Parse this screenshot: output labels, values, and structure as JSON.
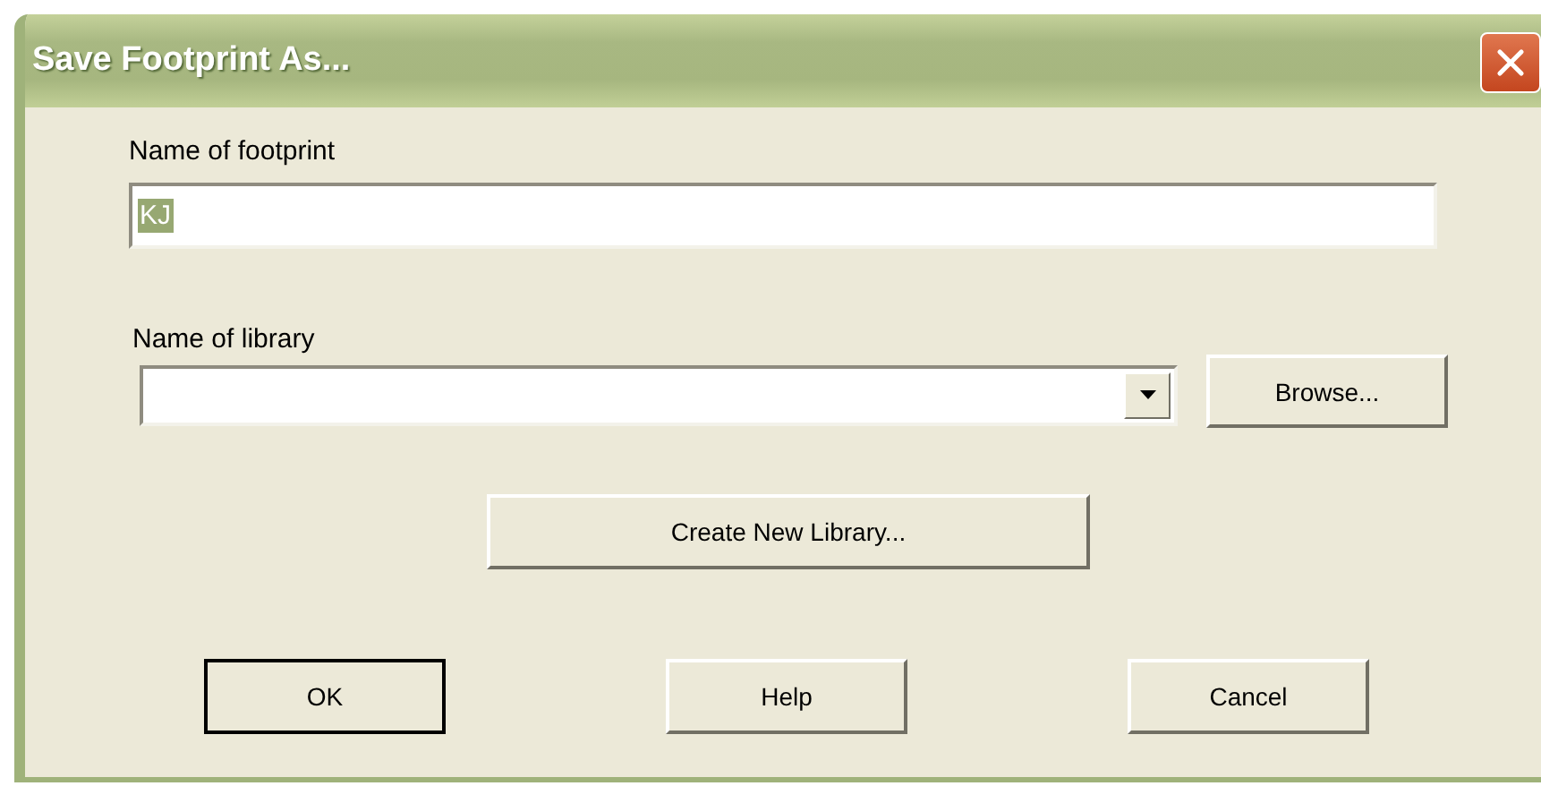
{
  "window": {
    "title": "Save Footprint As..."
  },
  "footprint": {
    "label": "Name of footprint",
    "value": "KJ",
    "value_selected": true
  },
  "library": {
    "label": "Name of library"
  },
  "buttons": [
    {
      "label": "Browse...",
      "kind": "browse",
      "default": false
    },
    {
      "label": "Create New Library...",
      "kind": "create",
      "default": false
    },
    {
      "label": "OK",
      "kind": "action",
      "default": true
    },
    {
      "label": "Help",
      "kind": "action",
      "default": false
    },
    {
      "label": "Cancel",
      "kind": "action",
      "default": false
    }
  ]
}
